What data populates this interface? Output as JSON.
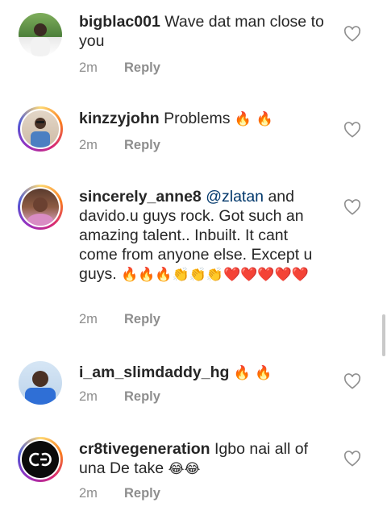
{
  "comments": [
    {
      "username": "bigblac001",
      "text": " Wave dat man close to you",
      "mention": "",
      "time": "2m",
      "reply": "Reply",
      "emoji": ""
    },
    {
      "username": "kinzzyjohn",
      "text": " Problems ",
      "mention": "",
      "time": "2m",
      "reply": "Reply",
      "emoji": "🔥 🔥"
    },
    {
      "username": "sincerely_anne8",
      "mention": "@zlatan",
      "text": "  and davido.u guys rock. Got such an amazing  talent.. Inbuilt.  It cant come from anyone else. Except u guys. ",
      "time": "2m",
      "reply": "Reply",
      "emoji": "🔥🔥🔥👏👏👏❤️❤️❤️❤️❤️"
    },
    {
      "username": "i_am_slimdaddy_hg",
      "text": " ",
      "mention": "",
      "time": "2m",
      "reply": "Reply",
      "emoji": "🔥 🔥"
    },
    {
      "username": "cr8tivegeneration",
      "text": " Igbo nai all of una De take ",
      "mention": "",
      "time": "2m",
      "reply": "Reply",
      "emoji": "😂😂"
    }
  ],
  "icons": {
    "like": "heart-outline-icon"
  },
  "colors": {
    "mention": "#00376b",
    "meta": "#8e8e8e",
    "text": "#262626"
  }
}
